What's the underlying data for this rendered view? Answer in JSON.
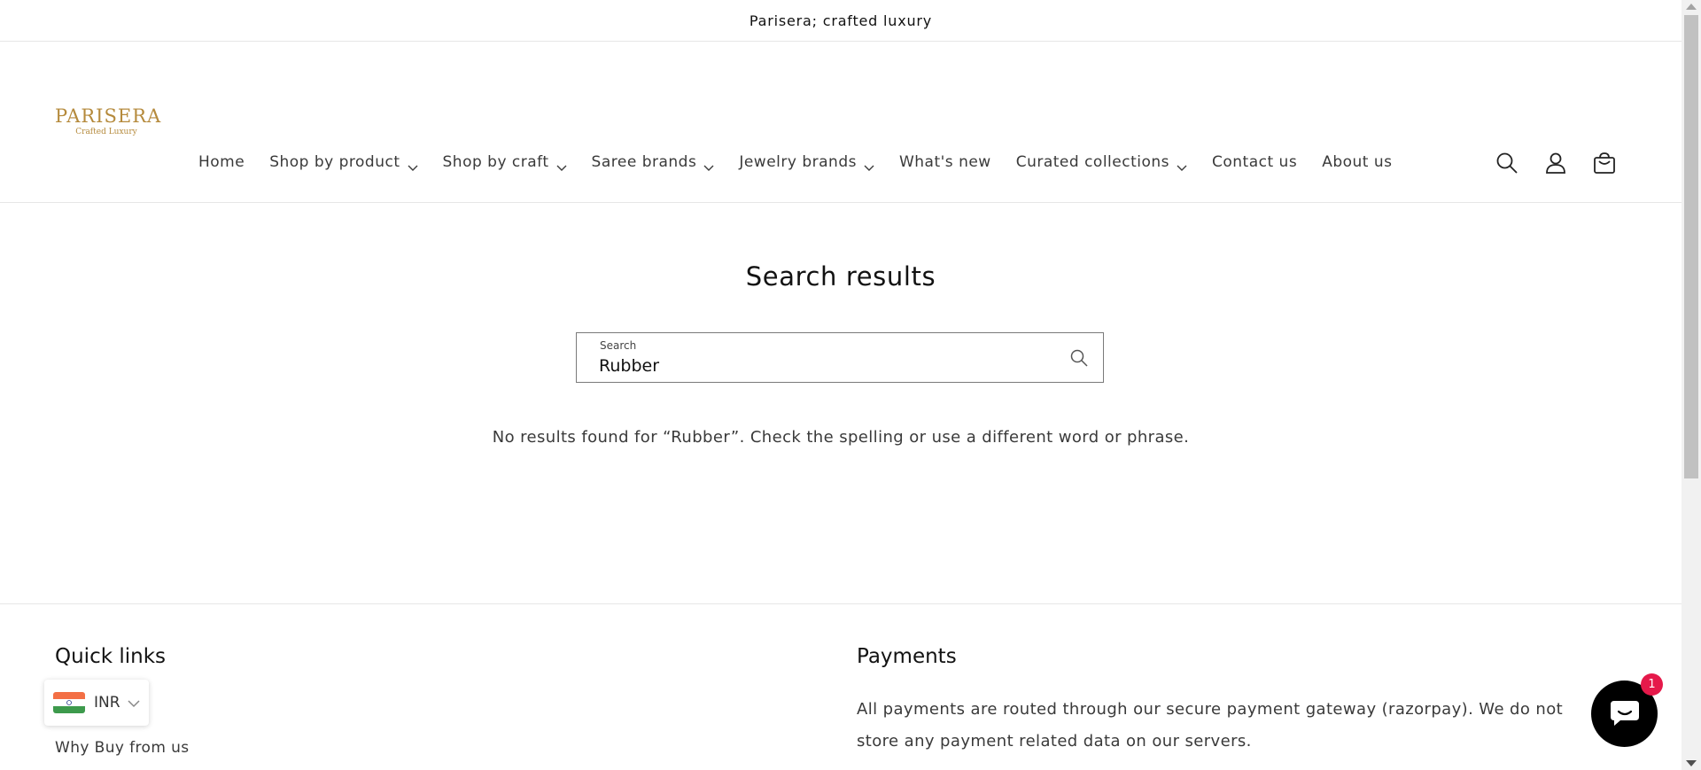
{
  "announcement": "Parisera; crafted luxury",
  "logo": {
    "name": "PARISERA",
    "tagline": "Crafted Luxury"
  },
  "nav": {
    "items": [
      {
        "label": "Home",
        "dropdown": false
      },
      {
        "label": "Shop by product",
        "dropdown": true
      },
      {
        "label": "Shop by craft",
        "dropdown": true
      },
      {
        "label": "Saree brands",
        "dropdown": true
      },
      {
        "label": "Jewelry brands",
        "dropdown": true
      },
      {
        "label": "What's new",
        "dropdown": false
      },
      {
        "label": "Curated collections",
        "dropdown": true
      },
      {
        "label": "Contact us",
        "dropdown": false
      },
      {
        "label": "About us",
        "dropdown": false
      }
    ]
  },
  "header_icons": [
    "search-icon",
    "account-icon",
    "cart-icon"
  ],
  "main": {
    "title": "Search results",
    "search": {
      "label": "Search",
      "value": "Rubber"
    },
    "no_results": "No results found for “Rubber”. Check the spelling or use a different word or phrase."
  },
  "footer": {
    "quick_links_title": "Quick links",
    "link_why_buy": "Why Buy from us",
    "payments_title": "Payments",
    "payments_text": "All payments are routed through our secure payment gateway (razorpay). We do not store any payment related data on our servers."
  },
  "currency": {
    "code": "INR",
    "icon": "india-flag-icon"
  },
  "chat": {
    "badge": "1",
    "icon": "chat-icon"
  },
  "colors": {
    "brand_gold": "#b58a3c",
    "badge_red": "#e5194a",
    "text": "#121212"
  }
}
